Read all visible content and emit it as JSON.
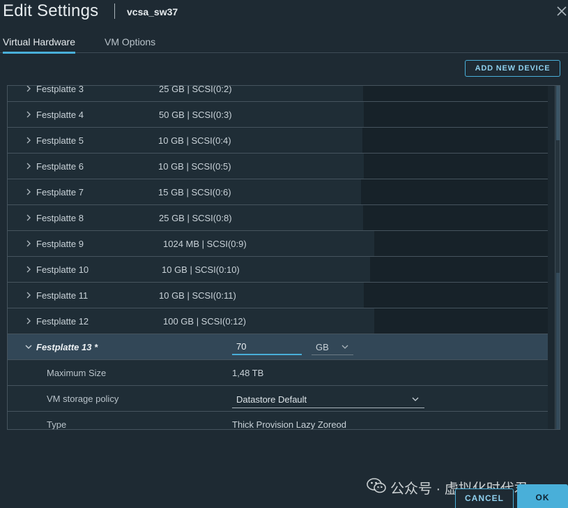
{
  "header": {
    "title": "Edit Settings",
    "vm_name": "vcsa_sw37",
    "close_icon": "close-icon"
  },
  "tabs": [
    {
      "label": "Virtual Hardware",
      "active": true
    },
    {
      "label": "VM Options",
      "active": false
    }
  ],
  "toolbar": {
    "add_device_label": "ADD NEW DEVICE"
  },
  "disks": [
    {
      "name": "Festplatte 3",
      "value": "25 GB | SCSI(0:2)"
    },
    {
      "name": "Festplatte 4",
      "value": "50 GB | SCSI(0:3)"
    },
    {
      "name": "Festplatte 5",
      "value": "10 GB | SCSI(0:4)"
    },
    {
      "name": "Festplatte 6",
      "value": "10 GB | SCSI(0:5)"
    },
    {
      "name": "Festplatte 7",
      "value": "15 GB | SCSI(0:6)"
    },
    {
      "name": "Festplatte 8",
      "value": "25 GB | SCSI(0:8)"
    },
    {
      "name": "Festplatte 9",
      "value": "1024 MB | SCSI(0:9)"
    },
    {
      "name": "Festplatte 10",
      "value": "10 GB | SCSI(0:10)"
    },
    {
      "name": "Festplatte 11",
      "value": "10 GB | SCSI(0:11)"
    },
    {
      "name": "Festplatte 12",
      "value": "100 GB | SCSI(0:12)"
    }
  ],
  "expanded_disk": {
    "name": "Festplatte 13 *",
    "size_value": "70",
    "unit": "GB",
    "details": {
      "max_size_label": "Maximum Size",
      "max_size_value": "1,48 TB",
      "policy_label": "VM storage policy",
      "policy_value": "Datastore Default",
      "type_label": "Type",
      "type_value": "Thick Provision Lazy Zoreod"
    }
  },
  "footer": {
    "watermark": "公众号 · 虚拟化时代君",
    "cancel_label": "CANCEL",
    "ok_label": "OK"
  },
  "colors": {
    "accent": "#49afd9",
    "background": "#1e2a33",
    "expanded_row": "#324757"
  }
}
